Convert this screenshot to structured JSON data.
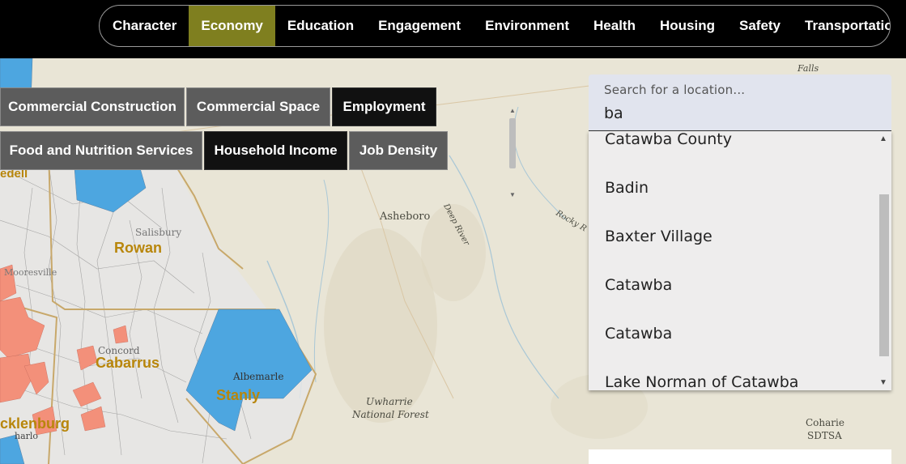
{
  "nav": {
    "tabs": [
      {
        "label": "Character"
      },
      {
        "label": "Economy"
      },
      {
        "label": "Education"
      },
      {
        "label": "Engagement"
      },
      {
        "label": "Environment"
      },
      {
        "label": "Health"
      },
      {
        "label": "Housing"
      },
      {
        "label": "Safety"
      },
      {
        "label": "Transportation"
      }
    ],
    "active": "Economy",
    "active_color": "#7f7f1f"
  },
  "subcategories": {
    "items": [
      {
        "label": "Commercial Construction"
      },
      {
        "label": "Commercial Space"
      },
      {
        "label": "Employment"
      },
      {
        "label": "Food and Nutrition Services"
      },
      {
        "label": "Household Income"
      },
      {
        "label": "Job Density"
      }
    ]
  },
  "search": {
    "label": "Search for a location...",
    "value": "ba",
    "results": [
      {
        "label": "Catawba County"
      },
      {
        "label": "Badin"
      },
      {
        "label": "Baxter Village"
      },
      {
        "label": "Catawba"
      },
      {
        "label": "Catawba"
      },
      {
        "label": "Lake Norman of Catawba"
      }
    ]
  },
  "map": {
    "place_labels": {
      "falls": "Falls",
      "asheboro": "Asheboro",
      "deep_river": "Deep River",
      "rocky_river": "Rocky R",
      "salisbury": "Salisbury",
      "mooresville": "Mooresville",
      "concord": "Concord",
      "albemarle": "Albemarle",
      "uwharrie": "Uwharrie",
      "national_forest": "National Forest",
      "coharie": "Coharie",
      "sdtsa": "SDTSA",
      "iredell": "edell",
      "charlotte": "harlo"
    },
    "county_labels": {
      "rowan": "Rowan",
      "cabarrus": "Cabarrus",
      "stanly": "Stanly",
      "mecklenburg": "cklenburg"
    },
    "colors": {
      "blue": "#4da6e0",
      "salmon": "#f3907a",
      "border": "#c8a86a"
    }
  }
}
